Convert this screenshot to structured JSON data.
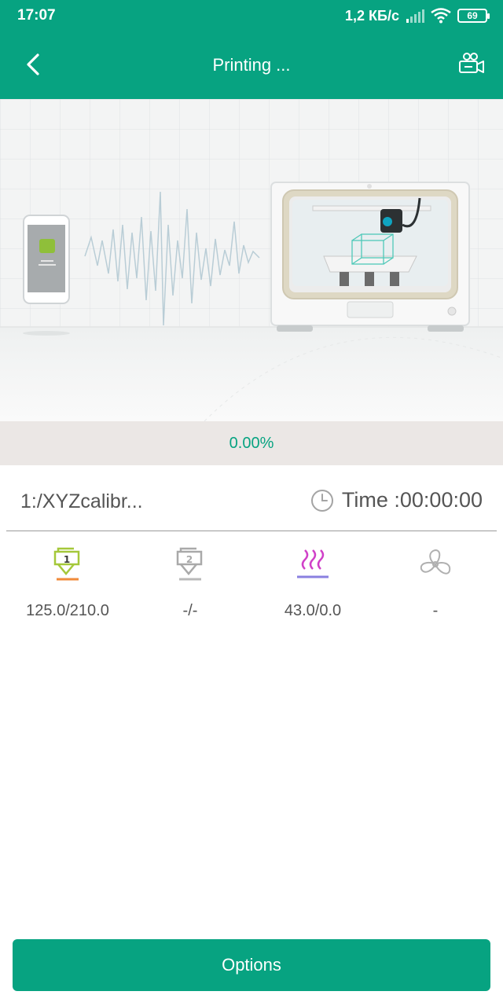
{
  "status_bar": {
    "time": "17:07",
    "net_speed": "1,2 КБ/с",
    "battery": "69",
    "icons": [
      "signal-icon",
      "wifi-icon",
      "battery-icon"
    ]
  },
  "app_bar": {
    "title": "Printing ...",
    "back_icon": "chevron-left-icon",
    "camera_icon": "camera-icon"
  },
  "progress": {
    "text": "0.00%",
    "fraction": 0
  },
  "job": {
    "file_name": "1:/XYZcalibr...",
    "time_text": "Time :00:00:00"
  },
  "stats": [
    {
      "icon": "extruder-1-icon",
      "value": "125.0/210.0"
    },
    {
      "icon": "extruder-2-icon",
      "value": "-/-"
    },
    {
      "icon": "heated-bed-icon",
      "value": "43.0/0.0"
    },
    {
      "icon": "fan-icon",
      "value": "-"
    }
  ],
  "footer": {
    "options_label": "Options"
  },
  "colors": {
    "accent": "#07a381",
    "progress_track": "#ebe7e5",
    "text_secondary": "#555555",
    "extruder1": "#a5c83a",
    "bed_heat": "#d040c8"
  }
}
